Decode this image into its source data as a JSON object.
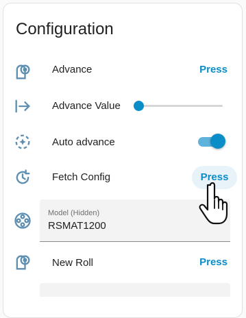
{
  "card": {
    "title": "Configuration"
  },
  "rows": [
    {
      "icon": "toilet-paper-roll-icon",
      "label": "Advance",
      "action": "Press"
    },
    {
      "icon": "arrow-right-to-line-icon",
      "label": "Advance Value",
      "slider_value": 0
    },
    {
      "icon": "auto-advance-icon",
      "label": "Auto advance",
      "toggle_on": true
    },
    {
      "icon": "refresh-clock-icon",
      "label": "Fetch Config",
      "action": "Press",
      "hovered": true
    },
    {
      "icon": "film-reel-icon",
      "select_label": "Model (Hidden)",
      "select_value": "RSMAT1200"
    },
    {
      "icon": "toilet-paper-roll-icon",
      "label": "New Roll",
      "action": "Press"
    }
  ],
  "colors": {
    "accent": "#0b8dc8",
    "icon": "#5f8fb0"
  }
}
